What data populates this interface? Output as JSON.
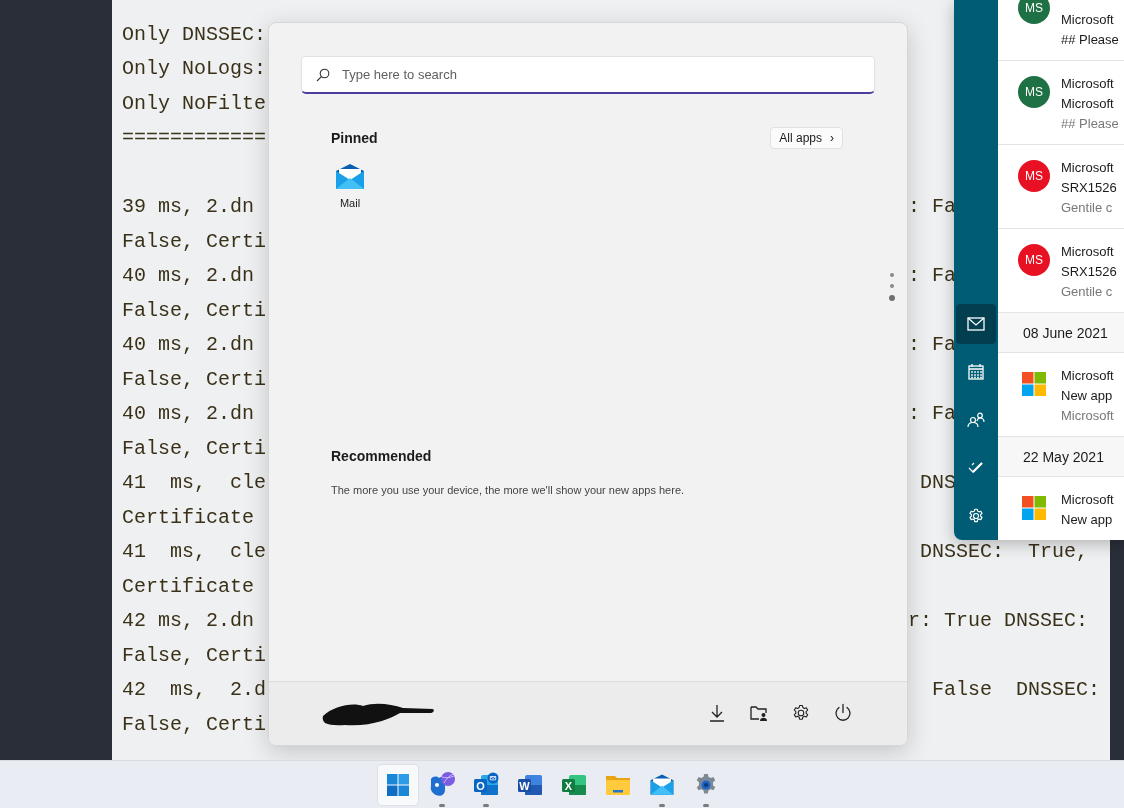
{
  "terminal": {
    "lines": [
      {
        "kind": "split",
        "left": "Only DNSSEC:"
      },
      {
        "kind": "split",
        "left": "Only NoLogs:"
      },
      {
        "kind": "split",
        "left": "Only NoFilte"
      },
      {
        "kind": "split",
        "left": "============"
      },
      {
        "kind": "blank"
      },
      {
        "kind": "split",
        "left": "39 ms, 2.dn",
        "right": ": Fa"
      },
      {
        "kind": "split",
        "left": "False, Certi"
      },
      {
        "kind": "split",
        "left": "40 ms, 2.dn",
        "right": ": Fa"
      },
      {
        "kind": "split",
        "left": "False, Certi"
      },
      {
        "kind": "split",
        "left": "40 ms, 2.dn",
        "right": ": Fa"
      },
      {
        "kind": "split",
        "left": "False, Certi"
      },
      {
        "kind": "split",
        "left": "40 ms, 2.dn",
        "right": ": Fa"
      },
      {
        "kind": "split",
        "left": "False, Certi"
      },
      {
        "kind": "split",
        "left": "41  ms,  cle",
        "right": " DNS"
      },
      {
        "kind": "split",
        "left": "Certificate"
      },
      {
        "kind": "split",
        "left": "41  ms,  cle",
        "right": " DNSSEC:  True,"
      },
      {
        "kind": "split",
        "left": "Certificate"
      },
      {
        "kind": "split",
        "left": "42 ms, 2.dn",
        "right": "r: True DNSSEC:"
      },
      {
        "kind": "split",
        "left": "False, Certi"
      },
      {
        "kind": "split",
        "left": "42  ms,  2.d",
        "right": "  False  DNSSEC:"
      },
      {
        "kind": "split",
        "left": "False, Certi"
      }
    ]
  },
  "start_menu": {
    "search": {
      "placeholder": "Type here to search"
    },
    "pinned_title": "Pinned",
    "all_apps": "All apps",
    "all_apps_chevron": "›",
    "pinned": [
      {
        "kind": "mail",
        "label": "Mail"
      }
    ],
    "pager": [
      {
        "selected": false
      },
      {
        "selected": false
      },
      {
        "selected": true
      }
    ],
    "recommended_title": "Recommended",
    "recommended_text": "The more you use your device, the more we'll show your new apps here.",
    "footer_buttons": [
      {
        "kind": "download"
      },
      {
        "kind": "folder"
      },
      {
        "kind": "settings"
      },
      {
        "kind": "power"
      }
    ]
  },
  "mail": {
    "rail": [
      {
        "kind": "mail",
        "selected": true
      },
      {
        "kind": "calendar",
        "selected": false
      },
      {
        "kind": "people",
        "selected": false
      },
      {
        "kind": "todo",
        "selected": false
      },
      {
        "kind": "settings",
        "selected": false
      }
    ],
    "list": [
      {
        "kind": "avatar",
        "avatar": "MS",
        "color": "#1e7145",
        "lines": [
          "Microsoft",
          "## Please"
        ]
      },
      {
        "kind": "avatar",
        "avatar": "MS",
        "color": "#1e7145",
        "lines": [
          "Microsoft",
          "Microsoft",
          "## Please"
        ]
      },
      {
        "kind": "avatar",
        "avatar": "MS",
        "color": "#e81123",
        "lines": [
          "Microsoft",
          "SRX1526",
          "Gentile c"
        ]
      },
      {
        "kind": "avatar",
        "avatar": "MS",
        "color": "#e81123",
        "lines": [
          "Microsoft",
          "SRX1526",
          "Gentile c"
        ]
      },
      {
        "kind": "date",
        "label": "08 June 2021"
      },
      {
        "kind": "logo",
        "lines": [
          "Microsoft",
          "New app",
          "Microsoft"
        ]
      },
      {
        "kind": "date",
        "label": "22 May 2021"
      },
      {
        "kind": "logo",
        "lines": [
          "Microsoft",
          "New app"
        ]
      }
    ]
  },
  "taskbar": [
    {
      "kind": "start",
      "selected": true,
      "running": false
    },
    {
      "kind": "chat",
      "selected": false,
      "running": true
    },
    {
      "kind": "office",
      "glyph": "O",
      "selected": false,
      "running": true
    },
    {
      "kind": "office",
      "glyph": "W",
      "selected": false,
      "running": false
    },
    {
      "kind": "office",
      "glyph": "X",
      "selected": false,
      "running": false
    },
    {
      "kind": "folder",
      "selected": false,
      "running": false
    },
    {
      "kind": "mail",
      "selected": false,
      "running": true
    },
    {
      "kind": "settings",
      "selected": false,
      "running": true
    }
  ]
}
